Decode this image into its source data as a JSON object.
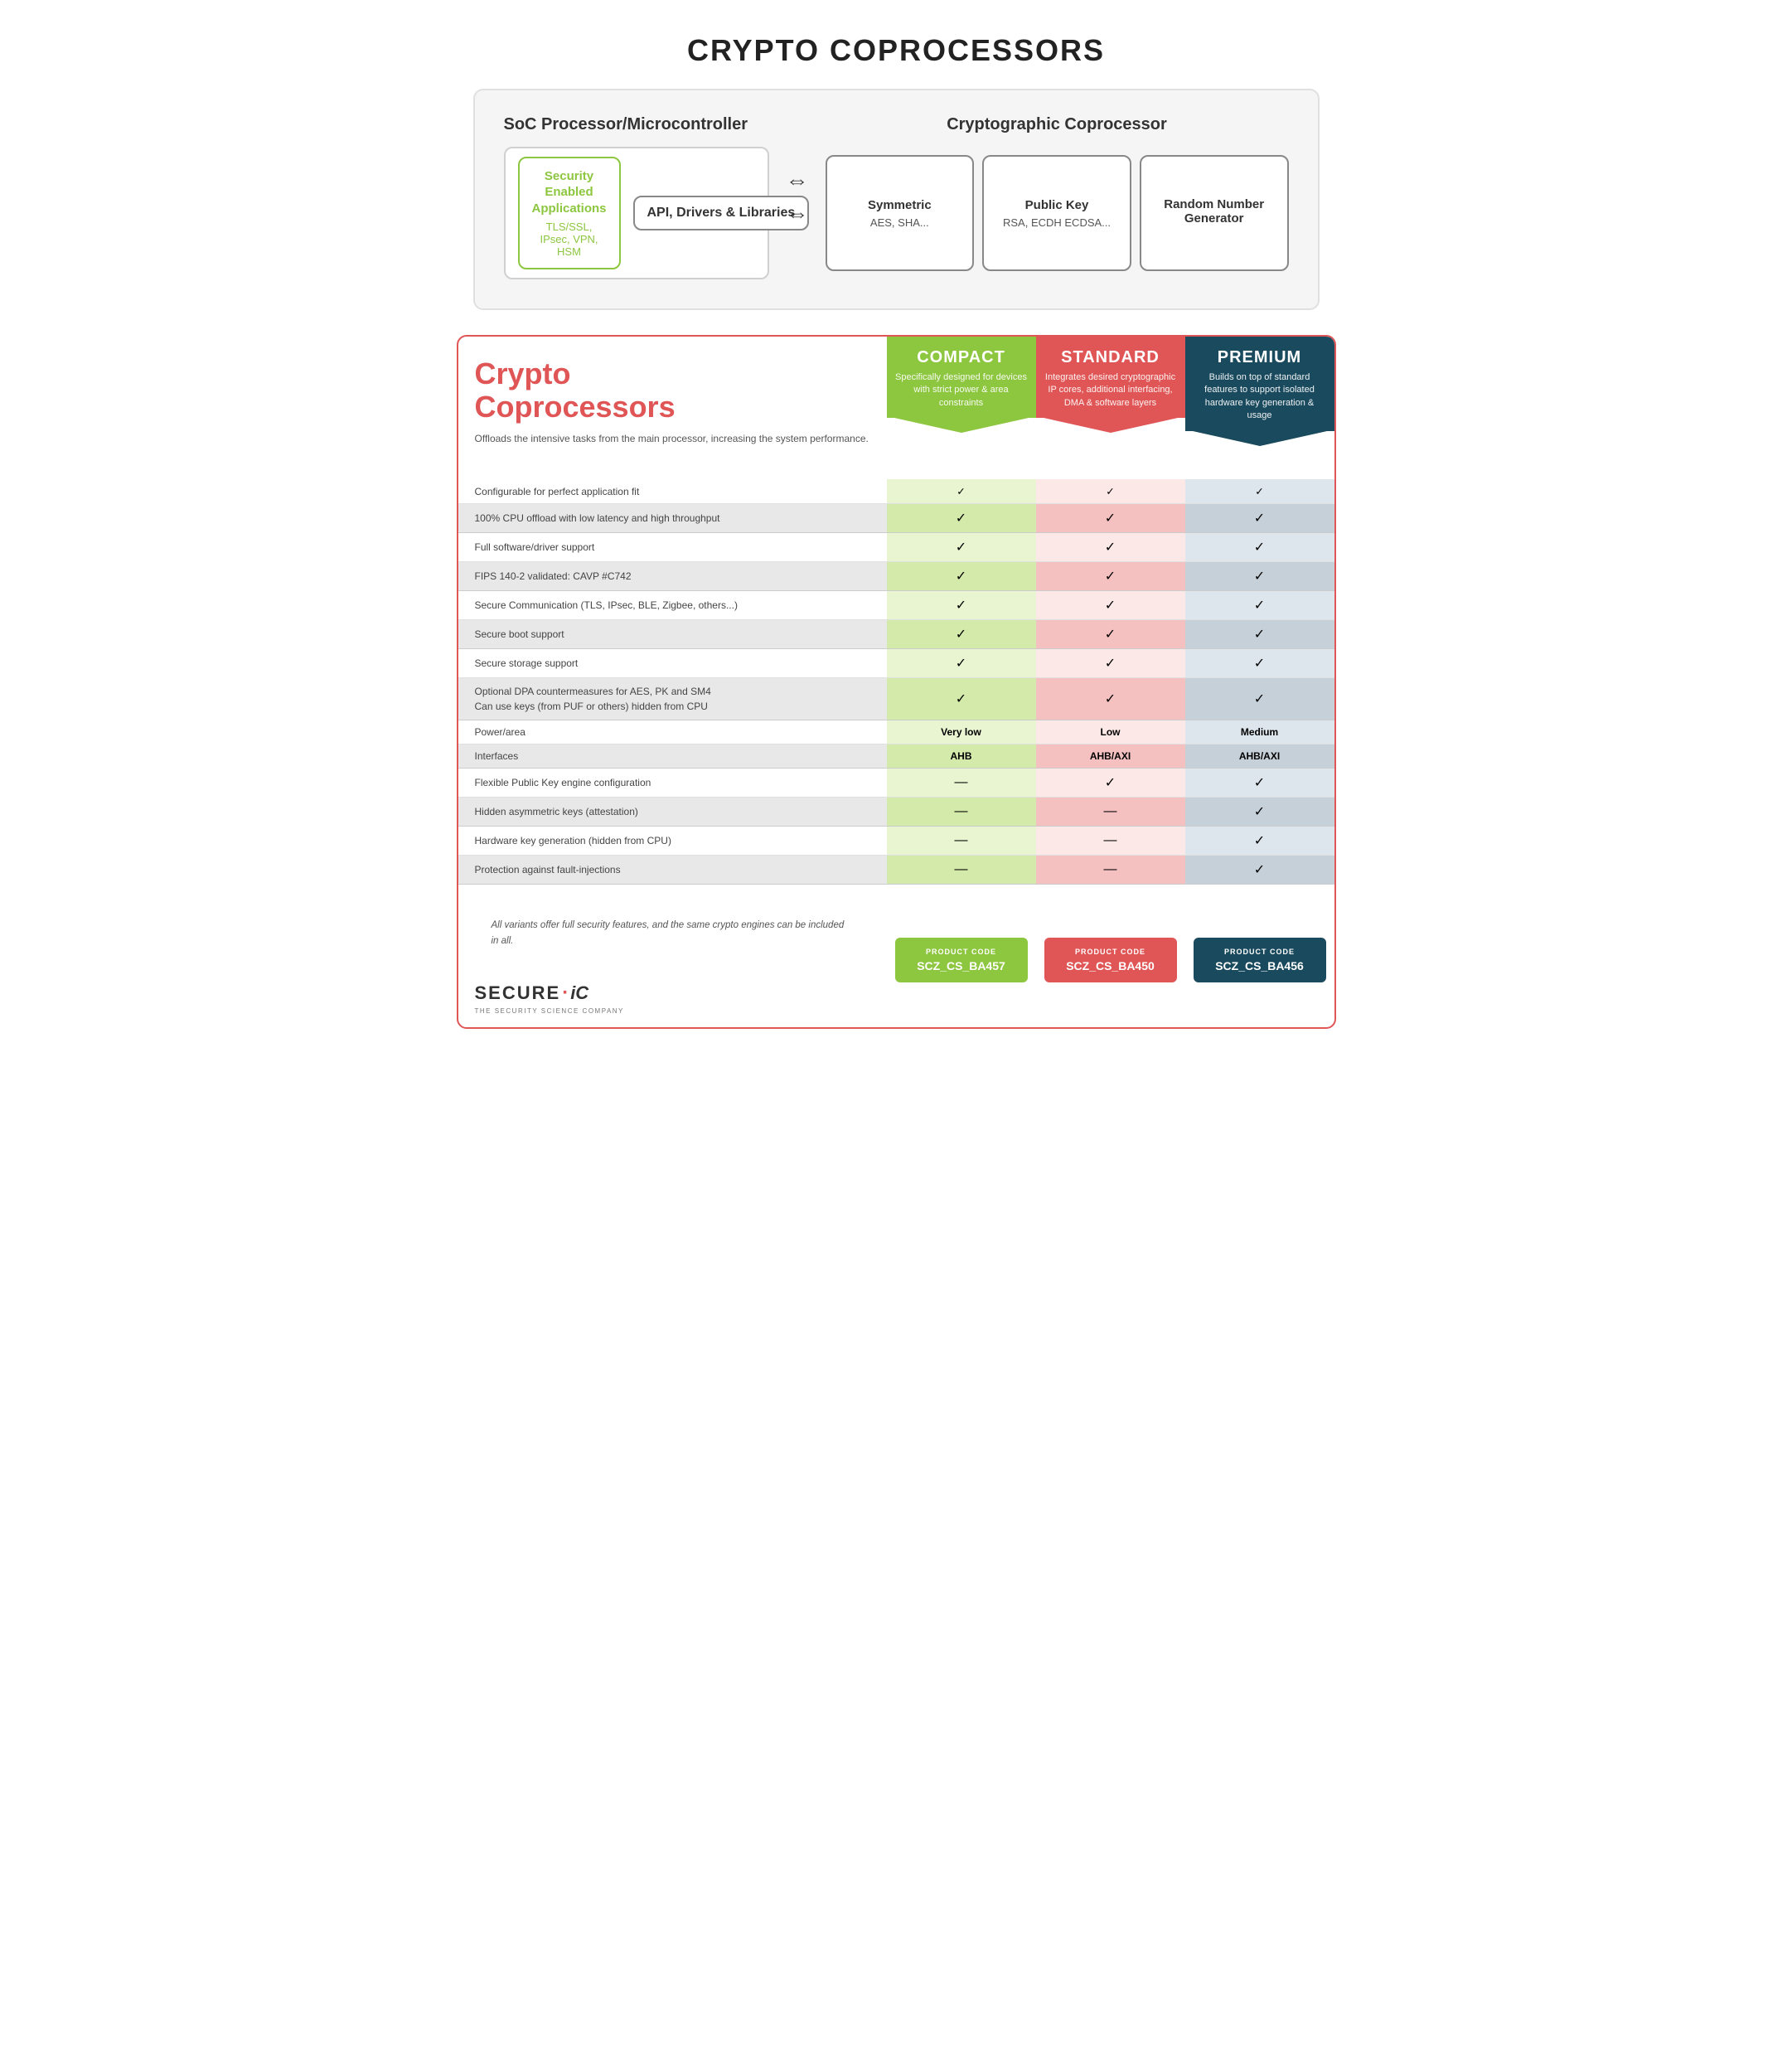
{
  "title": "CRYPTO COPROCESSORS",
  "top": {
    "left_title": "SoC Processor/Microcontroller",
    "right_title": "Cryptographic Coprocessor",
    "sec_app_title": "Security Enabled Applications",
    "sec_app_sub": "TLS/SSL, IPsec, VPN, HSM",
    "api_label": "API, Drivers & Libraries",
    "boxes": [
      {
        "title": "Symmetric",
        "sub": "AES, SHA..."
      },
      {
        "title": "Public Key",
        "sub": "RSA, ECDH ECDSA..."
      },
      {
        "title": "Random Number Generator",
        "sub": ""
      }
    ]
  },
  "bottom": {
    "main_title_line1": "Crypto",
    "main_title_line2": "Coprocessors",
    "subtitle": "Offloads the intensive tasks from the main processor, increasing the system performance.",
    "columns": [
      {
        "id": "compact",
        "name": "COMPACT",
        "desc": "Specifically designed for devices with strict power & area constraints"
      },
      {
        "id": "standard",
        "name": "STANDARD",
        "desc": "Integrates desired cryptographic IP cores, additional interfacing, DMA & software layers"
      },
      {
        "id": "premium",
        "name": "PREMIUM",
        "desc": "Builds on top of standard features to support isolated hardware key generation & usage"
      }
    ],
    "rows": [
      {
        "label": "Configurable for perfect application fit",
        "shaded": false,
        "compact": "check",
        "standard": "check",
        "premium": "check"
      },
      {
        "label": "100% CPU offload with low latency and high throughput",
        "shaded": true,
        "compact": "check",
        "standard": "check",
        "premium": "check"
      },
      {
        "label": "Full software/driver support",
        "shaded": false,
        "compact": "check",
        "standard": "check",
        "premium": "check"
      },
      {
        "label": "FIPS 140-2 validated: CAVP #C742",
        "shaded": true,
        "compact": "check",
        "standard": "check",
        "premium": "check"
      },
      {
        "label": "Secure Communication (TLS, IPsec, BLE, Zigbee, others...)",
        "shaded": false,
        "compact": "check",
        "standard": "check",
        "premium": "check"
      },
      {
        "label": "Secure boot support",
        "shaded": true,
        "compact": "check",
        "standard": "check",
        "premium": "check"
      },
      {
        "label": "Secure storage support",
        "shaded": false,
        "compact": "check",
        "standard": "check",
        "premium": "check"
      },
      {
        "label": "Optional DPA countermeasures for AES, PK and SM4\nCan use keys (from PUF or others) hidden from CPU",
        "shaded": true,
        "compact": "check",
        "standard": "check",
        "premium": "check"
      },
      {
        "label": "Power/area",
        "shaded": false,
        "compact": "Very low",
        "standard": "Low",
        "premium": "Medium",
        "bold": true
      },
      {
        "label": "Interfaces",
        "shaded": true,
        "compact": "AHB",
        "standard": "AHB/AXI",
        "premium": "AHB/AXI",
        "bold": true
      },
      {
        "label": "Flexible Public Key engine configuration",
        "shaded": false,
        "compact": "dash",
        "standard": "check",
        "premium": "check"
      },
      {
        "label": "Hidden asymmetric keys (attestation)",
        "shaded": true,
        "compact": "dash",
        "standard": "dash",
        "premium": "check"
      },
      {
        "label": "Hardware key generation (hidden from CPU)",
        "shaded": false,
        "compact": "dash",
        "standard": "dash",
        "premium": "check"
      },
      {
        "label": "Protection against fault-injections",
        "shaded": true,
        "compact": "dash",
        "standard": "dash",
        "premium": "check"
      }
    ],
    "footer_note": "All variants offer full security features, and the same crypto engines can be included in all.",
    "products": [
      {
        "id": "compact",
        "label": "PRODUCT CODE",
        "code": "SCZ_CS_BA457"
      },
      {
        "id": "standard",
        "label": "PRODUCT CODE",
        "code": "SCZ_CS_BA450"
      },
      {
        "id": "premium",
        "label": "PRODUCT CODE",
        "code": "SCZ_CS_BA456"
      }
    ],
    "logo": {
      "name": "SECURE",
      "dot": "·",
      "suffix": "iC",
      "tagline": "THE SECURITY SCIENCE COMPANY"
    }
  }
}
